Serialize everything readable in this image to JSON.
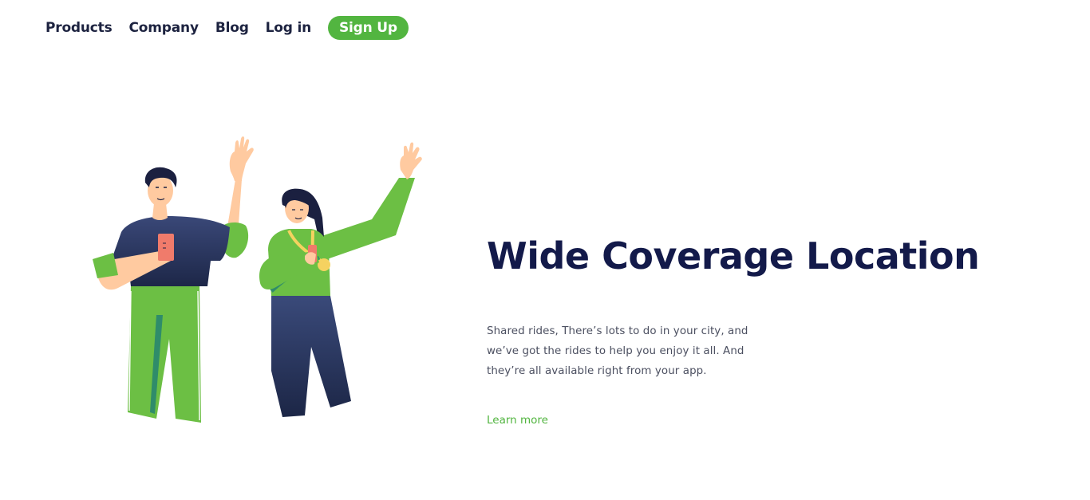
{
  "nav": {
    "items": [
      {
        "label": "Products"
      },
      {
        "label": "Company"
      },
      {
        "label": "Blog"
      },
      {
        "label": "Log in"
      }
    ],
    "signup_label": "Sign Up"
  },
  "hero": {
    "title": "Wide Coverage Location",
    "body": "Shared rides, There’s lots to do in your city, and we’ve got the rides to help you enjoy it all. And they’re all available right from your app.",
    "link_label": "Learn more"
  },
  "colors": {
    "accent": "#52b540",
    "heading": "#131a4a",
    "nav_text": "#1d2340",
    "body_text": "#4b4f60"
  }
}
